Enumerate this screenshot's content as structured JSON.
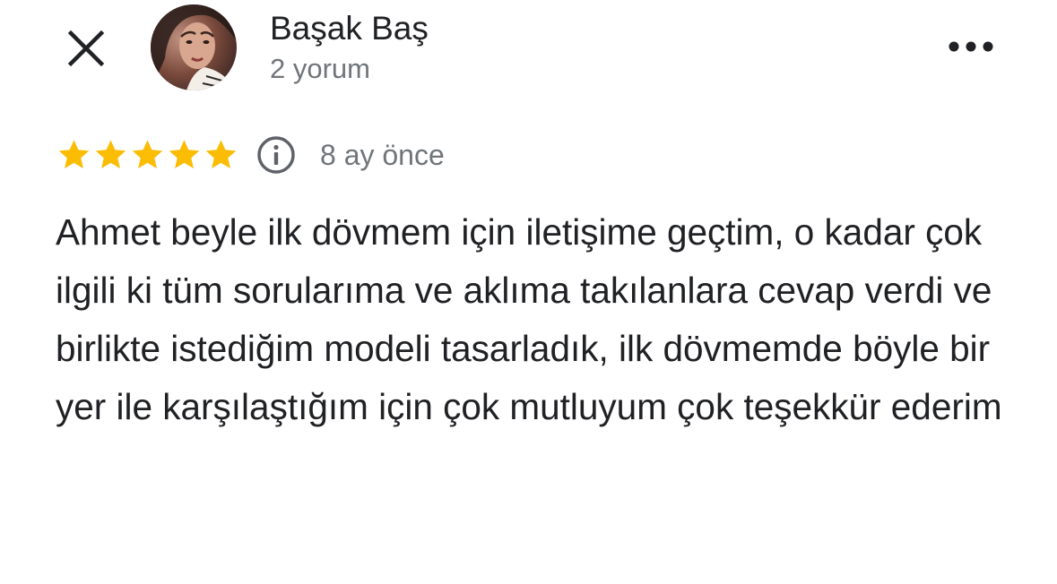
{
  "header": {
    "close_icon": "close-icon",
    "more_icon": "more-horizontal-icon"
  },
  "reviewer": {
    "name": "Başak Baş",
    "review_count": "2 yorum",
    "avatar": "profile-photo"
  },
  "review": {
    "rating": 5,
    "rating_max": 5,
    "star_color": "#fbbc04",
    "info_icon": "info-icon",
    "date": "8 ay önce",
    "text": "Ahmet beyle ilk dövmem için iletişime geçtim, o kadar çok ilgili ki tüm sorularıma ve aklıma takılanlara cevap verdi ve birlikte istediğim modeli tasarladık, ilk dövmemde böyle bir yer ile karşılaştığım için çok mutluyum çok teşekkür ederim"
  }
}
